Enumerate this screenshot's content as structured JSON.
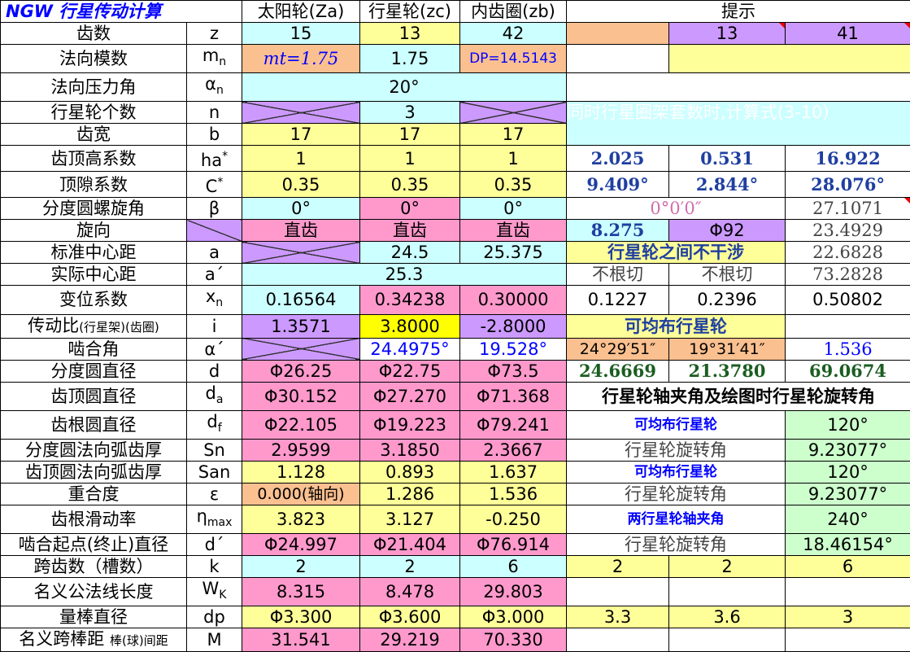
{
  "header": {
    "title": "NGW 行星传动计算",
    "col_sun": "太阳轮(Za)",
    "col_planet": "行星轮(zc)",
    "col_ring": "内齿圈(zb)",
    "hint": "提示"
  },
  "rows": {
    "z": {
      "label": "齿数",
      "sym": "z",
      "sun": "15",
      "planet": "13",
      "ring": "42",
      "h2": "13",
      "h3": "41"
    },
    "mn": {
      "label": "法向模数",
      "sym": "m",
      "sub": "n",
      "sun": "mt=1.75",
      "planet": "1.75",
      "ring": "DP=14.5143"
    },
    "an": {
      "label": "法向压力角",
      "sym": "α",
      "sub": "n",
      "val": "20°"
    },
    "n": {
      "label": "行星轮个数",
      "sym": "n",
      "planet": "3",
      "note": "同时行星圈架套数时,计算式(3-10)"
    },
    "b": {
      "label": "齿宽",
      "sym": "b",
      "sun": "17",
      "planet": "17",
      "ring": "17"
    },
    "ha": {
      "label": "齿顶高系数",
      "sym": "ha",
      "sup": "*",
      "sun": "1",
      "planet": "1",
      "ring": "1",
      "h1": "2.025",
      "h2": "0.531",
      "h3": "16.922"
    },
    "c": {
      "label": "顶隙系数",
      "sym": "C",
      "sup": "*",
      "sun": "0.35",
      "planet": "0.35",
      "ring": "0.35",
      "h1": "9.409°",
      "h2": "2.844°",
      "h3": "28.076°"
    },
    "beta": {
      "label": "分度圆螺旋角",
      "sym": "β",
      "sun": "0°",
      "planet": "0°",
      "ring": "0°",
      "h12": "0°0′0″",
      "h3": "27.1071"
    },
    "dir": {
      "label": "旋向",
      "planet": "直齿",
      "sun": "直齿",
      "ring": "直齿",
      "h1": "8.275",
      "h2": "Φ92",
      "h3": "23.4929"
    },
    "a": {
      "label": "标准中心距",
      "sym": "a",
      "planet": "24.5",
      "ring": "25.375",
      "h12": "行星轮之间不干涉",
      "h3": "22.6828"
    },
    "ap": {
      "label": "实际中心距",
      "sym": "a´",
      "val": "25.3",
      "h1": "不根切",
      "h2": "不根切",
      "h3": "73.2828"
    },
    "xn": {
      "label": "变位系数",
      "sym": "x",
      "sub": "n",
      "sun": "0.16564",
      "planet": "0.34238",
      "ring": "0.30000",
      "h1": "0.1227",
      "h2": "0.2396",
      "h3": "0.50802"
    },
    "i": {
      "label": "传动比",
      "label_small": "(行星架)(齿圈)",
      "sym": "i",
      "sun": "1.3571",
      "planet": "3.8000",
      "ring": "-2.8000",
      "h12": "可均布行星轮"
    },
    "alpha": {
      "label": "啮合角",
      "sym": "α´",
      "planet": "24.4975°",
      "ring": "19.528°",
      "h1": "24°29′51″",
      "h2": "19°31′41″",
      "h3": "1.536"
    },
    "d": {
      "label": "分度圆直径",
      "sym": "d",
      "sun": "Φ26.25",
      "planet": "Φ22.75",
      "ring": "Φ73.5",
      "h1": "24.6669",
      "h2": "21.3780",
      "h3": "69.0674"
    },
    "da": {
      "label": "齿顶圆直径",
      "sym": "d",
      "sub": "a",
      "sun": "Φ30.152",
      "planet": "Φ27.270",
      "ring": "Φ71.368",
      "h123": "行星轮轴夹角及绘图时行星轮旋转角"
    },
    "df": {
      "label": "齿根圆直径",
      "sym": "d",
      "sub": "f",
      "sun": "Φ22.105",
      "planet": "Φ19.223",
      "ring": "Φ79.241",
      "h12": "可均布行星轮",
      "h3": "120°"
    },
    "sn": {
      "label": "分度圆法向弧齿厚",
      "sym": "Sn",
      "sun": "2.9599",
      "planet": "3.1850",
      "ring": "2.3667",
      "h12": "行星轮旋转角",
      "h3": "9.23077°"
    },
    "san": {
      "label": "齿顶圆法向弧齿厚",
      "sym": "San",
      "sun": "1.128",
      "planet": "0.893",
      "ring": "1.637",
      "h12": "可均布行星轮",
      "h3": "120°"
    },
    "eps": {
      "label": "重合度",
      "sym": "ε",
      "sun": "0.000(轴向)",
      "planet": "1.286",
      "ring": "1.536",
      "h12": "行星轮旋转角",
      "h3": "9.23077°"
    },
    "eta": {
      "label": "齿根滑动率",
      "sym": "η",
      "sub": "max",
      "sun": "3.823",
      "planet": "3.127",
      "ring": "-0.250",
      "h12": "两行星轮轴夹角",
      "h3": "240°"
    },
    "dp2": {
      "label": "啮合起点(终止)直径",
      "sym": "d´",
      "sun": "Φ24.997",
      "planet": "Φ21.404",
      "ring": "Φ76.914",
      "h12": "行星轮旋转角",
      "h3": "18.46154°"
    },
    "k": {
      "label": "跨齿数（槽数）",
      "sym": "k",
      "sun": "2",
      "planet": "2",
      "ring": "6",
      "h1": "2",
      "h2": "2",
      "h3": "6"
    },
    "wk": {
      "label": "名义公法线长度",
      "sym": "W",
      "sub": "K",
      "sun": "8.315",
      "planet": "8.478",
      "ring": "29.803"
    },
    "dp": {
      "label": "量棒直径",
      "sym": "dp",
      "sun": "Φ3.300",
      "planet": "Φ3.600",
      "ring": "Φ3.000",
      "h1": "3.3",
      "h2": "3.6",
      "h3": "3"
    },
    "m": {
      "label": "名义跨棒距",
      "label_small": "棒(球)间距",
      "sym": "M",
      "sun": "31.541",
      "planet": "29.219",
      "ring": "70.330"
    }
  }
}
